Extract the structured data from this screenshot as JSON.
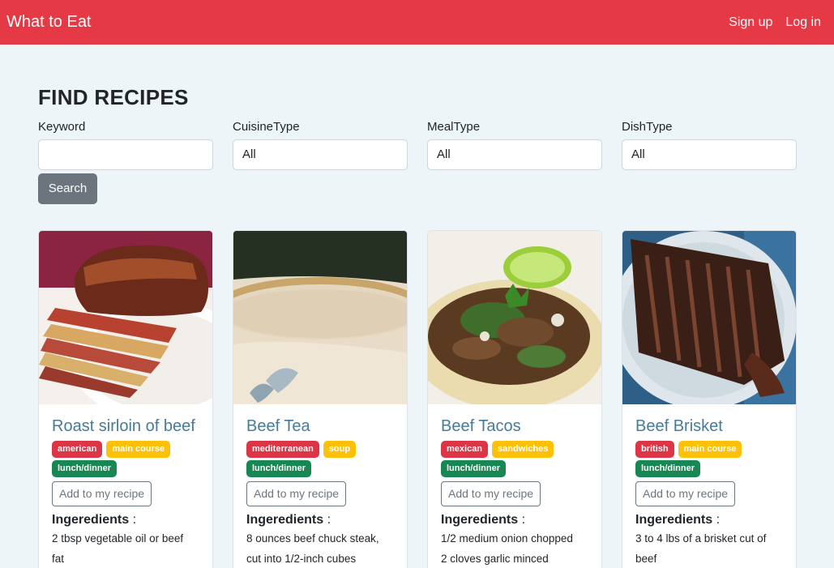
{
  "header": {
    "brand": "What to Eat",
    "signup": "Sign up",
    "login": "Log in"
  },
  "page": {
    "title": "FIND RECIPES"
  },
  "filters": {
    "keyword_label": "Keyword",
    "keyword_value": "",
    "cuisine_label": "CuisineType",
    "cuisine_value": "All",
    "meal_label": "MealType",
    "meal_value": "All",
    "dish_label": "DishType",
    "dish_value": "All",
    "search_label": "Search"
  },
  "recipes": [
    {
      "title": "Roast sirloin of beef",
      "tag1": "american",
      "tag2": "main course",
      "tag3": "lunch/dinner",
      "add_label": "Add to my recipe",
      "ingredients_label": "Ingeredients",
      "ingredients_line1": "2 tbsp vegetable oil or beef",
      "ingredients_line2": "fat",
      "image": "roast-sirloin-photo"
    },
    {
      "title": "Beef Tea",
      "tag1": "mediterranean",
      "tag2": "soup",
      "tag3": "lunch/dinner",
      "add_label": "Add to my recipe",
      "ingredients_label": "Ingeredients",
      "ingredients_line1": "8 ounces beef chuck steak,",
      "ingredients_line2": "cut into 1/2-inch cubes",
      "image": "beef-tea-cup-photo"
    },
    {
      "title": "Beef Tacos",
      "tag1": "mexican",
      "tag2": "sandwiches",
      "tag3": "lunch/dinner",
      "add_label": "Add to my recipe",
      "ingredients_label": "Ingeredients",
      "ingredients_line1": "1/2 medium onion chopped",
      "ingredients_line2": "2 cloves garlic minced",
      "image": "beef-tacos-photo"
    },
    {
      "title": "Beef Brisket",
      "tag1": "british",
      "tag2": "main course",
      "tag3": "lunch/dinner",
      "add_label": "Add to my recipe",
      "ingredients_label": "Ingeredients",
      "ingredients_line1": "3 to 4 lbs of a brisket cut of",
      "ingredients_line2": "beef",
      "image": "beef-brisket-photo"
    }
  ],
  "colors": {
    "navbar": "#e63946",
    "title": "#457b9d",
    "badge_red": "#dc3545",
    "badge_yellow": "#ffc107",
    "badge_green": "#198754",
    "page_bg": "#edf5f8"
  }
}
